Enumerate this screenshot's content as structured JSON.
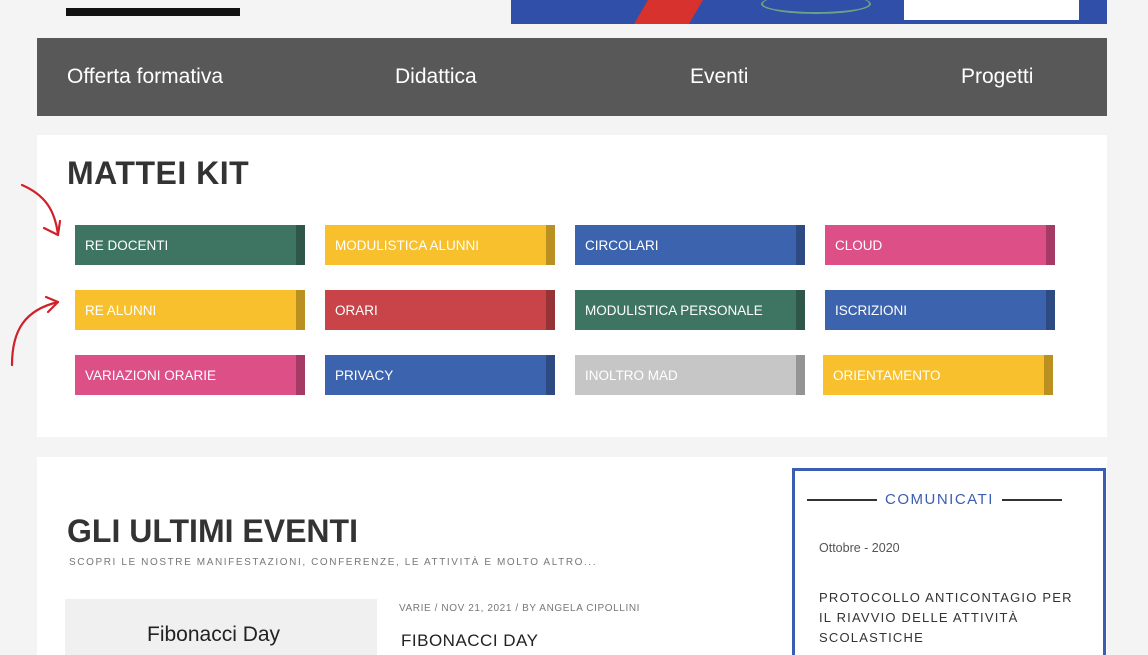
{
  "nav": {
    "items": [
      {
        "label": "Offerta formativa"
      },
      {
        "label": "Didattica"
      },
      {
        "label": "Eventi"
      },
      {
        "label": "Progetti"
      }
    ]
  },
  "kit": {
    "title": "MATTEI KIT",
    "buttons": [
      {
        "label": "RE DOCENTI",
        "color": "#3e7462"
      },
      {
        "label": "MODULISTICA ALUNNI",
        "color": "#f8c02c"
      },
      {
        "label": "CIRCOLARI",
        "color": "#3c63ae"
      },
      {
        "label": "CLOUD",
        "color": "#dd4f87"
      },
      {
        "label": "RE ALUNNI",
        "color": "#f8c02c"
      },
      {
        "label": "ORARI",
        "color": "#c84448"
      },
      {
        "label": "MODULISTICA PERSONALE",
        "color": "#3e7462"
      },
      {
        "label": "ISCRIZIONI",
        "color": "#3c63ae"
      },
      {
        "label": "VARIAZIONI ORARIE",
        "color": "#dd4f87"
      },
      {
        "label": "PRIVACY",
        "color": "#3c63ae"
      },
      {
        "label": "INOLTRO MAD",
        "color": "#c6c6c6"
      },
      {
        "label": "ORIENTAMENTO",
        "color": "#f8c02c"
      }
    ]
  },
  "events": {
    "title": "GLI ULTIMI EVENTI",
    "subtitle": "SCOPRI LE NOSTRE MANIFESTAZIONI, CONFERENZE, LE ATTIVITÀ E MOLTO ALTRO...",
    "post": {
      "thumb_text": "Fibonacci Day",
      "meta": "VARIE  /  NOV 21, 2021  /  BY  ANGELA CIPOLLINI",
      "title": "FIBONACCI DAY"
    }
  },
  "comunicati": {
    "label": "COMUNICATI",
    "date": "Ottobre - 2020",
    "text": "PROTOCOLLO ANTICONTAGIO PER IL RIAVVIO DELLE ATTIVITÀ SCOLASTICHE"
  },
  "colors": {
    "nav_bg": "#585858",
    "accent_blue": "#3b5db2",
    "annotation_red": "#d0202a"
  }
}
